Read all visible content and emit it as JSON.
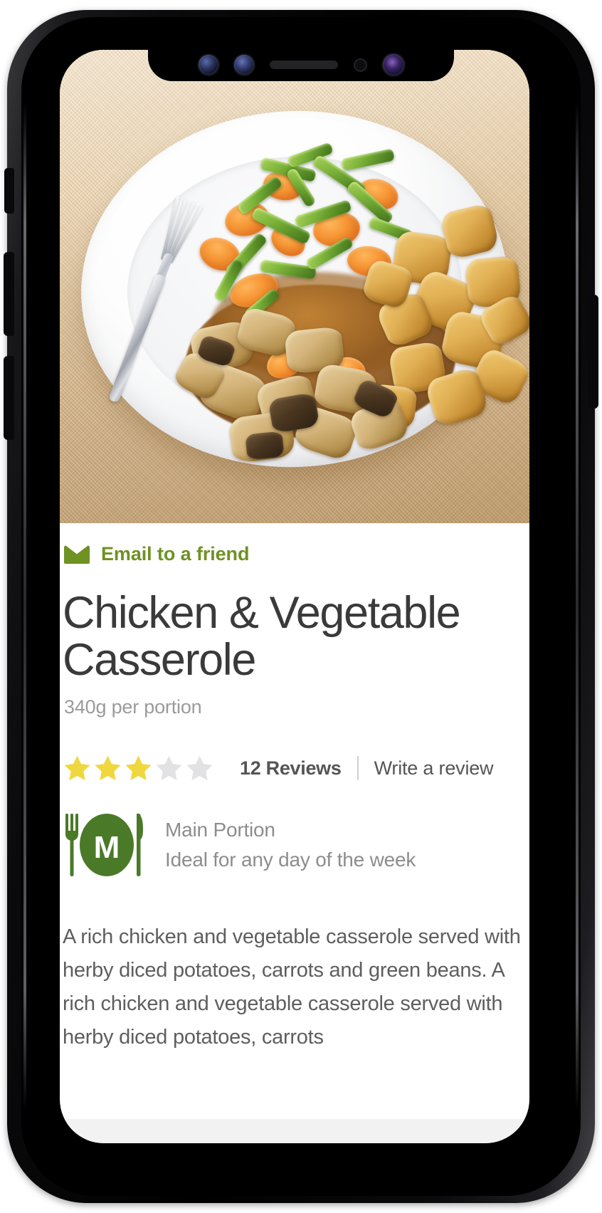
{
  "device": {
    "name": "smartphone-mockup",
    "notch_sensors": [
      "front-camera-icon",
      "front-camera-icon",
      "earpiece-speaker-icon",
      "proximity-sensor-icon",
      "front-camera-icon"
    ],
    "side_buttons": [
      "silent-switch",
      "volume-up-button",
      "volume-down-button",
      "power-button"
    ]
  },
  "colors": {
    "brand_green": "#6f9223",
    "badge_green": "#4a7a28",
    "star_filled": "#efd83f",
    "star_empty": "#e2e2e4",
    "title_text": "#3a3a3a",
    "muted_text": "#9b9b9b",
    "body_text": "#5e5e5e",
    "plate_white": "#ffffff",
    "tablecloth": "#e0c093"
  },
  "hero": {
    "image_alt": "Plate of chicken and vegetable casserole with diced potatoes, carrots and green beans, with a fork",
    "name": "recipe-hero-image"
  },
  "share": {
    "icon": "envelope-icon",
    "label": "Email to a friend"
  },
  "product": {
    "title": "Chicken & Vegetable Casserole",
    "portion": "340g per portion",
    "description": "A rich chicken and vegetable casserole served with herby diced potatoes, carrots and green beans. A rich chicken and vegetable casserole served with herby diced potatoes, carrots"
  },
  "rating": {
    "value": 3,
    "max": 5,
    "reviews_label": "12 Reviews",
    "separator": "|",
    "write_review_label": "Write a review"
  },
  "badge": {
    "icon": "fork-knife-plate-icon",
    "mark_letter": "M",
    "title": "Main Portion",
    "subtitle": "Ideal for any day of the week"
  }
}
